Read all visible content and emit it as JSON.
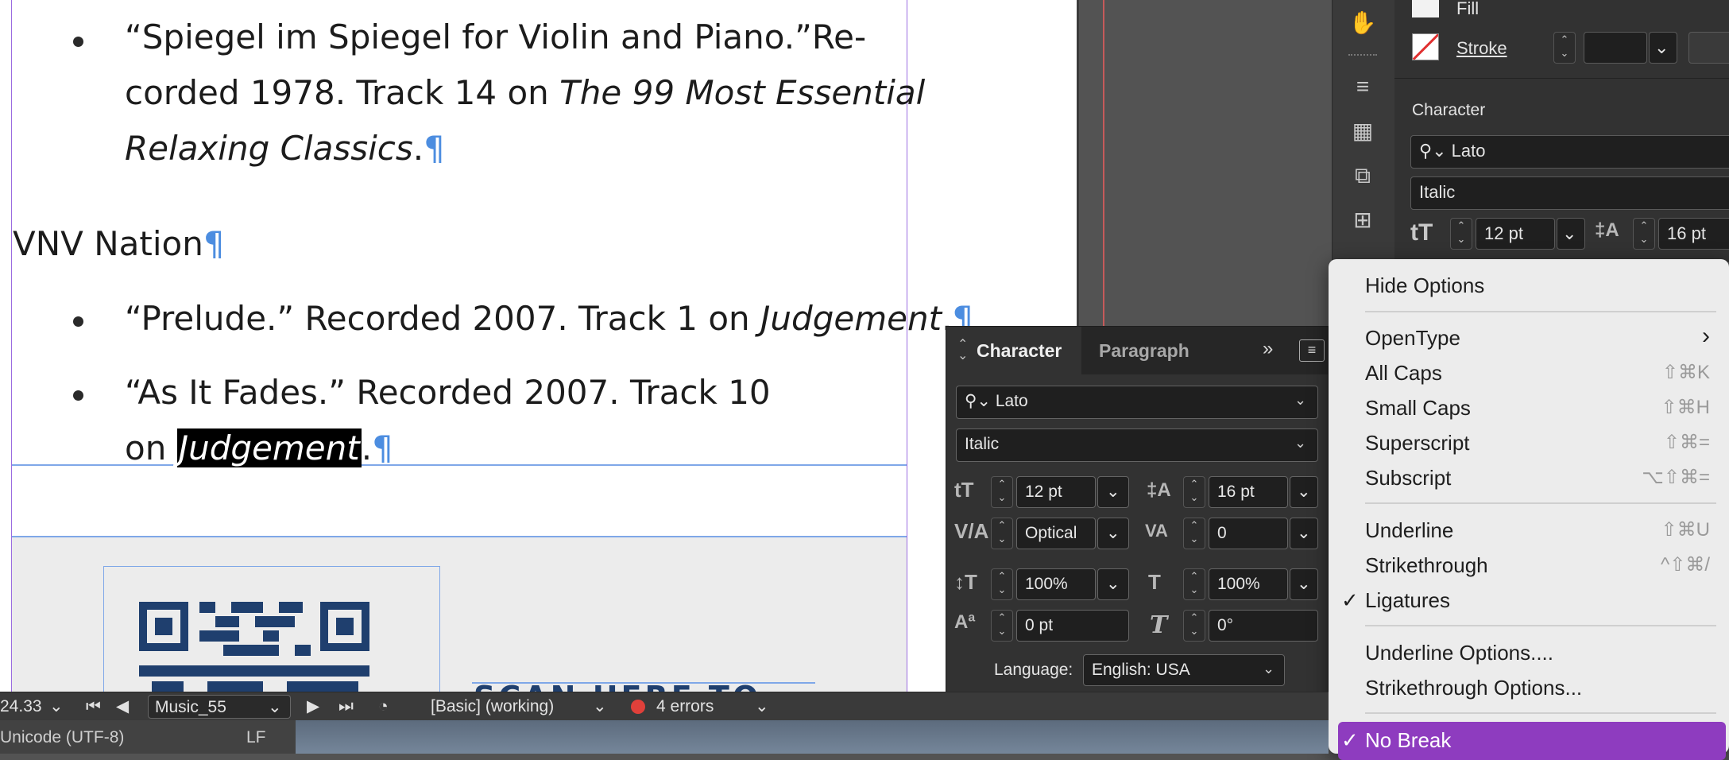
{
  "document": {
    "entry1": {
      "line1_text": "“Spiegel im Spiegel for Violin and Piano.”Re-",
      "line2_text": "corded 1978. Track 14 on",
      "line2_italic": "The 99 Most Essential",
      "line3_italic": "Relaxing Classics",
      "line3_end": "."
    },
    "heading": "VNV Nation",
    "entry2": {
      "text": "“Prelude.” Recorded 2007. Track 1 on",
      "italic": "Judgement",
      "end": "."
    },
    "entry3": {
      "line1_text": "“As It Fades.” Recorded 2007. Track 10",
      "line2_text": "on",
      "line2_selected": "Judgement",
      "line2_end": "."
    },
    "pilcrow": "¶",
    "scan_text": "SCAN HERE TO"
  },
  "properties_panel": {
    "fill_label": "Fill",
    "stroke_label": "Stroke",
    "character_header": "Character",
    "font_family": "Lato",
    "font_style": "Italic",
    "font_size": "12 pt",
    "leading": "16 pt"
  },
  "character_panel": {
    "tab_character": "Character",
    "tab_paragraph": "Paragraph",
    "font_family": "Lato",
    "font_style": "Italic",
    "font_size": "12 pt",
    "leading": "16 pt",
    "kerning": "Optical",
    "tracking": "0",
    "vertical_scale": "100%",
    "horizontal_scale": "100%",
    "baseline_shift": "0 pt",
    "skew": "0°",
    "language_label": "Language:",
    "language_value": "English: USA"
  },
  "menu": {
    "hide_options": "Hide Options",
    "opentype": "OpenType",
    "all_caps": "All Caps",
    "all_caps_sc": "⇧⌘K",
    "small_caps": "Small Caps",
    "small_caps_sc": "⇧⌘H",
    "superscript": "Superscript",
    "superscript_sc": "⇧⌘=",
    "subscript": "Subscript",
    "subscript_sc": "⌥⇧⌘=",
    "underline": "Underline",
    "underline_sc": "⇧⌘U",
    "strikethrough": "Strikethrough",
    "strikethrough_sc": "^⇧⌘/",
    "ligatures": "Ligatures",
    "underline_options": "Underline Options....",
    "strikethrough_options": "Strikethrough Options...",
    "no_break": "No Break",
    "check": "✓",
    "submenu_arrow": "›"
  },
  "status_bar": {
    "zoom": "24.33",
    "page": "Music_55",
    "profile": "[Basic] (working)",
    "errors": "4 errors",
    "error_color": "#e0403a",
    "encoding": "Unicode (UTF-8)",
    "line_ending": "LF"
  },
  "colors": {
    "selection_purple": "#8e3cbf",
    "frame_purple": "#9b6ce0",
    "guide_blue": "#7fa7e8",
    "qr_navy": "#1f3f6e"
  }
}
